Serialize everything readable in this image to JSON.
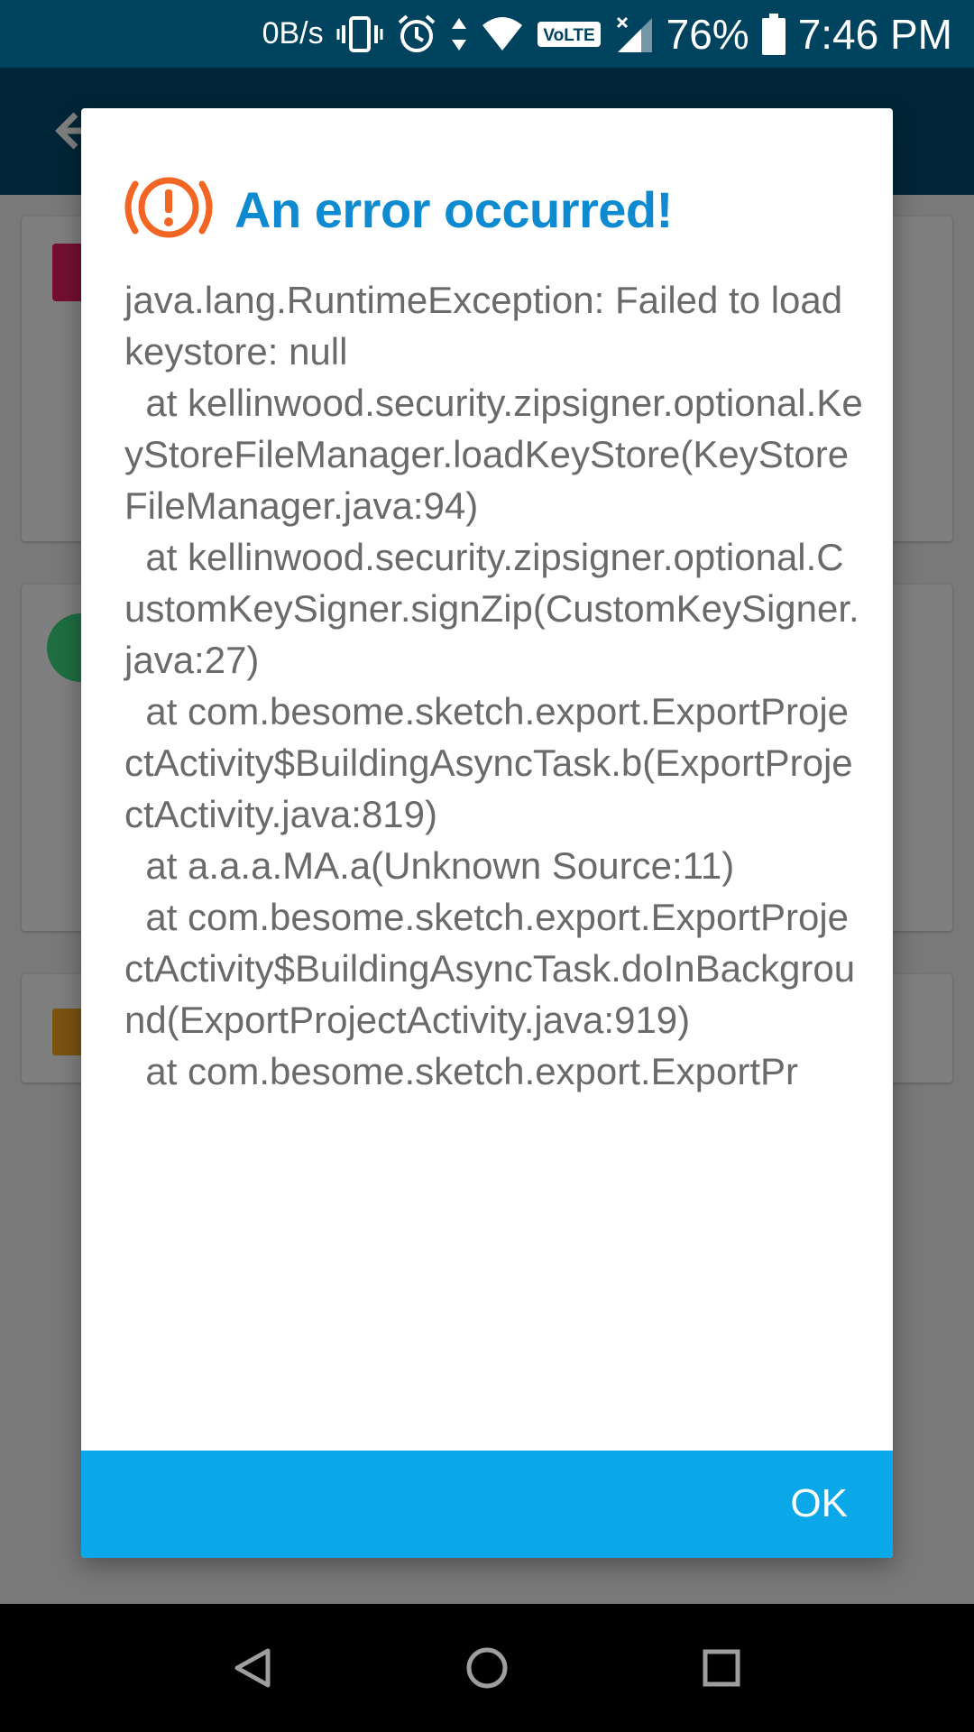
{
  "status_bar": {
    "net_speed": "0B/s",
    "volte": "VoLTE",
    "battery_percent": "76%",
    "time": "7:46 PM"
  },
  "dialog": {
    "title": "An error occurred!",
    "message": "java.lang.RuntimeException: Failed to load keystore: null\n  at kellinwood.security.zipsigner.optional.KeyStoreFileManager.loadKeyStore(KeyStoreFileManager.java:94)\n  at kellinwood.security.zipsigner.optional.CustomKeySigner.signZip(CustomKeySigner.java:27)\n  at com.besome.sketch.export.ExportProjectActivity$BuildingAsyncTask.b(ExportProjectActivity.java:819)\n  at a.a.a.MA.a(Unknown Source:11)\n  at com.besome.sketch.export.ExportProjectActivity$BuildingAsyncTask.doInBackground(ExportProjectActivity.java:919)\n  at com.besome.sketch.export.ExportPr",
    "ok_label": "OK"
  },
  "colors": {
    "title_blue": "#0e8ad0",
    "footer_blue": "#0aa8e8",
    "error_icon": "#f26522",
    "status_bar": "#00435f"
  }
}
